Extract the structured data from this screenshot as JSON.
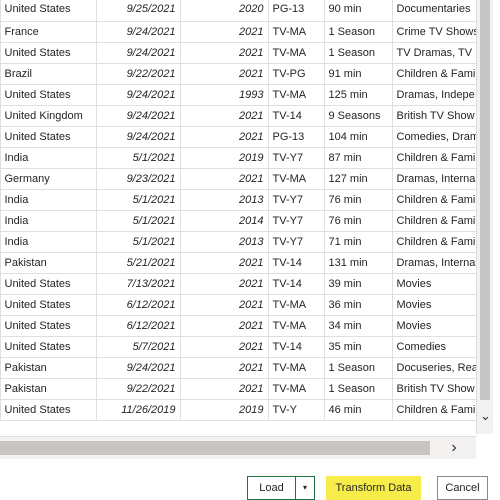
{
  "rows": [
    [
      "United States",
      "9/25/2021",
      "2020",
      "PG-13",
      "90 min",
      "Documentaries"
    ],
    [
      "France",
      "9/24/2021",
      "2021",
      "TV-MA",
      "1 Season",
      "Crime TV Shows"
    ],
    [
      "United States",
      "9/24/2021",
      "2021",
      "TV-MA",
      "1 Season",
      "TV Dramas, TV H"
    ],
    [
      "Brazil",
      "9/22/2021",
      "2021",
      "TV-PG",
      "91 min",
      "Children & Fami"
    ],
    [
      "United States",
      "9/24/2021",
      "1993",
      "TV-MA",
      "125 min",
      "Dramas, Indepe"
    ],
    [
      "United Kingdom",
      "9/24/2021",
      "2021",
      "TV-14",
      "9 Seasons",
      "British TV Show"
    ],
    [
      "United States",
      "9/24/2021",
      "2021",
      "PG-13",
      "104 min",
      "Comedies, Dram"
    ],
    [
      "India",
      "5/1/2021",
      "2019",
      "TV-Y7",
      "87 min",
      "Children & Fami"
    ],
    [
      "Germany",
      "9/23/2021",
      "2021",
      "TV-MA",
      "127 min",
      "Dramas, Interna"
    ],
    [
      "India",
      "5/1/2021",
      "2013",
      "TV-Y7",
      "76 min",
      "Children & Fami"
    ],
    [
      "India",
      "5/1/2021",
      "2014",
      "TV-Y7",
      "76 min",
      "Children & Fami"
    ],
    [
      "India",
      "5/1/2021",
      "2013",
      "TV-Y7",
      "71 min",
      "Children & Fami"
    ],
    [
      "Pakistan",
      "5/21/2021",
      "2021",
      "TV-14",
      "131 min",
      "Dramas, Interna"
    ],
    [
      "United States",
      "7/13/2021",
      "2021",
      "TV-14",
      "39 min",
      "Movies"
    ],
    [
      "United States",
      "6/12/2021",
      "2021",
      "TV-MA",
      "36 min",
      "Movies"
    ],
    [
      "United States",
      "6/12/2021",
      "2021",
      "TV-MA",
      "34 min",
      "Movies"
    ],
    [
      "United States",
      "5/7/2021",
      "2021",
      "TV-14",
      "35 min",
      "Comedies"
    ],
    [
      "Pakistan",
      "9/24/2021",
      "2021",
      "TV-MA",
      "1 Season",
      "Docuseries, Real"
    ],
    [
      "Pakistan",
      "9/22/2021",
      "2021",
      "TV-MA",
      "1 Season",
      "British TV Show"
    ],
    [
      "United States",
      "11/26/2019",
      "2019",
      "TV-Y",
      "46 min",
      "Children & Fami"
    ]
  ],
  "buttons": {
    "load": "Load",
    "load_arrow": "▾",
    "transform": "Transform Data",
    "cancel": "Cancel"
  },
  "scroll": {
    "down": "⌄",
    "right": "›"
  }
}
